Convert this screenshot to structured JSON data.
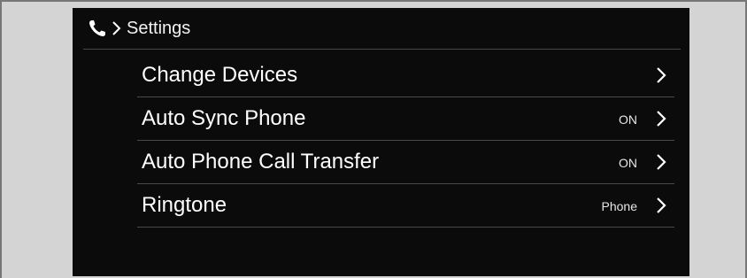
{
  "header": {
    "breadcrumb_icon": "phone-icon",
    "separator_icon": "chevron-right-icon",
    "title": "Settings"
  },
  "settings": {
    "items": [
      {
        "label": "Change Devices",
        "value": "",
        "icon": "chevron-right-icon"
      },
      {
        "label": "Auto Sync Phone",
        "value": "ON",
        "icon": "chevron-right-icon"
      },
      {
        "label": "Auto Phone Call Transfer",
        "value": "ON",
        "icon": "chevron-right-icon"
      },
      {
        "label": "Ringtone",
        "value": "Phone",
        "icon": "chevron-right-icon"
      }
    ]
  },
  "colors": {
    "screen_background": "#0b0b0b",
    "text": "#ffffff",
    "divider": "#4a4a4a",
    "bezel": "#d4d4d4"
  }
}
